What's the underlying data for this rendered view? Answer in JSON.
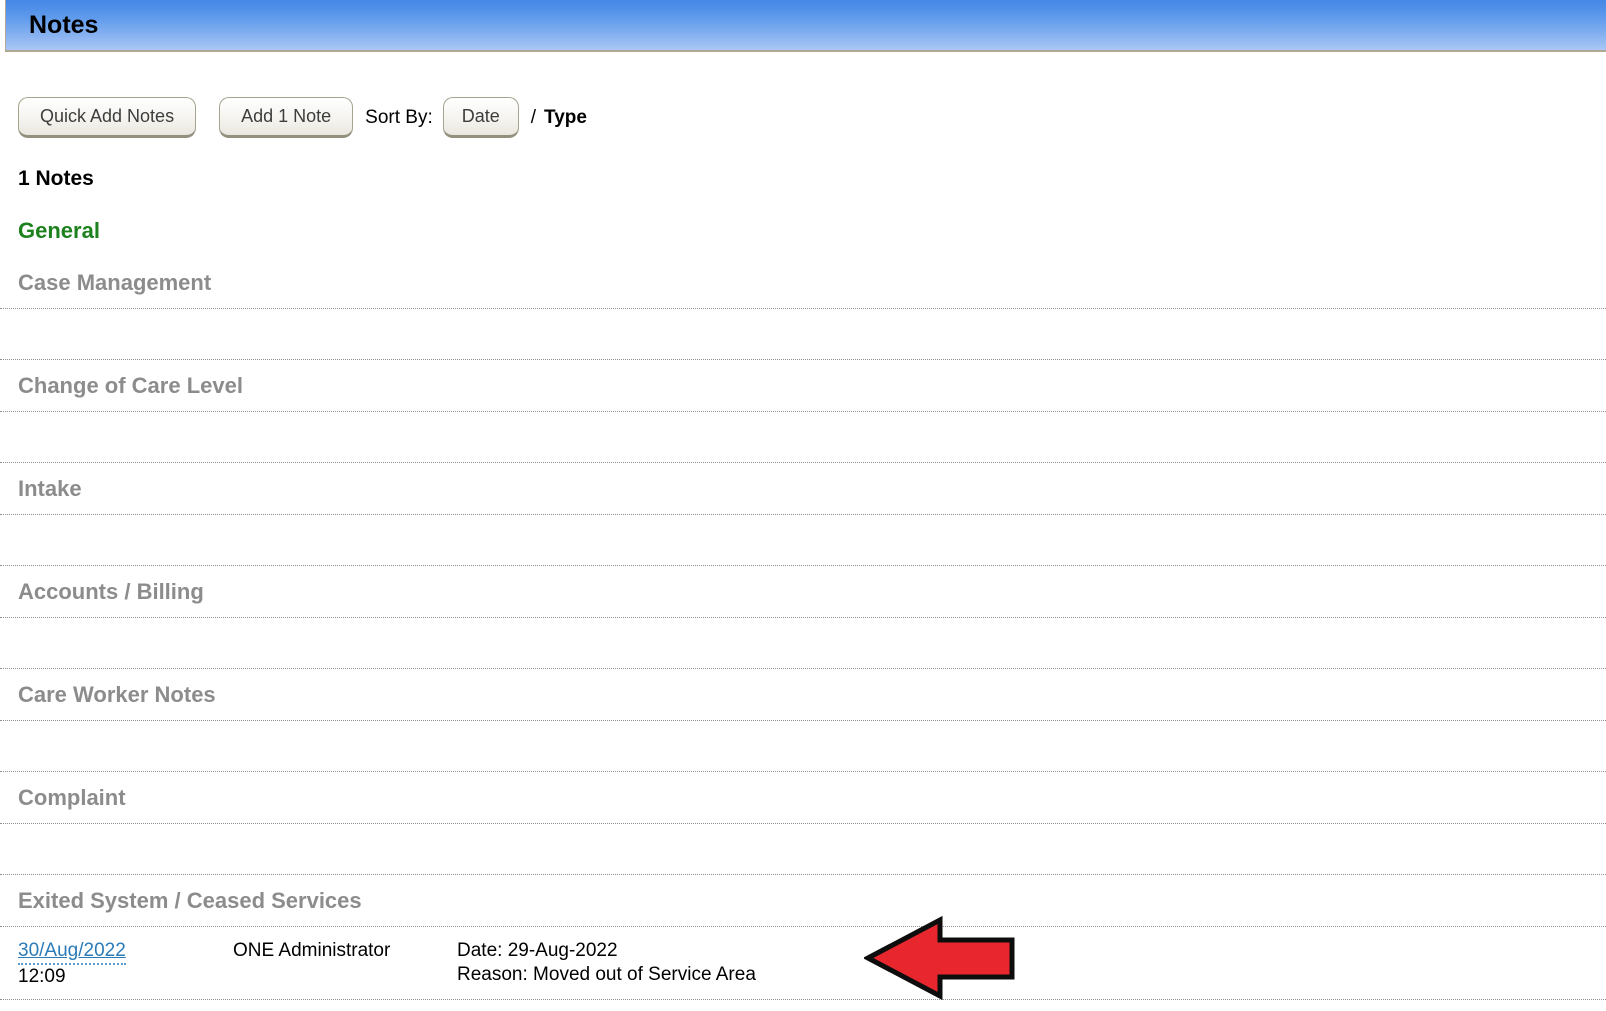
{
  "page": {
    "title": "Notes"
  },
  "toolbar": {
    "quick_add": "Quick Add Notes",
    "add_one": "Add 1 Note",
    "sort_by": "Sort By:",
    "sort_date": "Date",
    "separator": "/",
    "sort_type": "Type"
  },
  "summary": {
    "count_label": "1 Notes"
  },
  "highlight_category": "General",
  "categories": [
    {
      "label": "Case Management"
    },
    {
      "label": "Change of Care Level"
    },
    {
      "label": "Intake"
    },
    {
      "label": "Accounts / Billing"
    },
    {
      "label": "Care Worker Notes"
    },
    {
      "label": "Complaint"
    },
    {
      "label": "Exited System / Ceased Services",
      "note": {
        "date_link": "30/Aug/2022",
        "time": "12:09",
        "author": "ONE Administrator",
        "detail_line1": "Date: 29-Aug-2022",
        "detail_line2": "Reason: Moved out of Service Area"
      }
    }
  ],
  "colors": {
    "header_gradient_top": "#4487e6",
    "header_gradient_bottom": "#a9c6f4",
    "header_border_tan": "#b2a795",
    "category_gray": "#8c8c8c",
    "active_green": "#1d821d",
    "link_blue": "#2b7bb9",
    "arrow_red": "#e8262d",
    "dotted_line_gray": "#8f8f8f"
  }
}
